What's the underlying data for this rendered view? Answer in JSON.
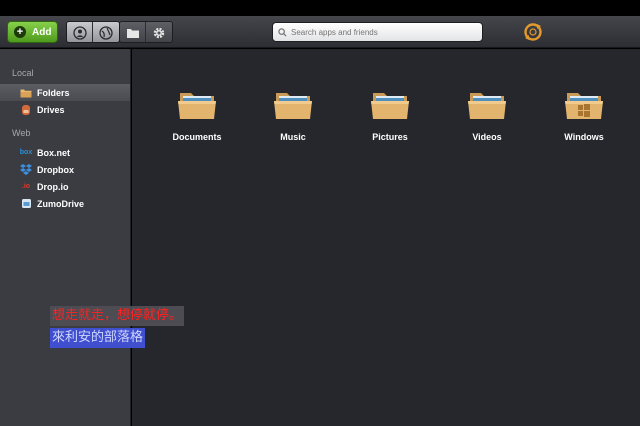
{
  "toolbar": {
    "add_label": "Add",
    "search_placeholder": "Search apps and friends"
  },
  "sidebar": {
    "sections": [
      {
        "label": "Local"
      },
      {
        "label": "Web"
      }
    ],
    "local_items": [
      {
        "label": "Folders",
        "icon": "folder-icon",
        "selected": true
      },
      {
        "label": "Drives",
        "icon": "drive-icon"
      }
    ],
    "web_items": [
      {
        "label": "Box.net",
        "icon": "boxnet-icon"
      },
      {
        "label": "Dropbox",
        "icon": "dropbox-icon"
      },
      {
        "label": "Drop.io",
        "icon": "dropio-icon"
      },
      {
        "label": "ZumoDrive",
        "icon": "zumodrive-icon"
      }
    ]
  },
  "folders": [
    {
      "label": "Documents"
    },
    {
      "label": "Music"
    },
    {
      "label": "Pictures"
    },
    {
      "label": "Videos"
    },
    {
      "label": "Windows"
    }
  ],
  "overlay": {
    "line1": "想走就走，想停就停。",
    "line2": "來利安的部落格"
  },
  "colors": {
    "add_button": "#5fae2c",
    "main_bg": "#26272c",
    "sidebar_bg": "#3a3c42",
    "overlay_red": "#ff2222",
    "overlay_blue_bg": "#3f4fcf"
  }
}
